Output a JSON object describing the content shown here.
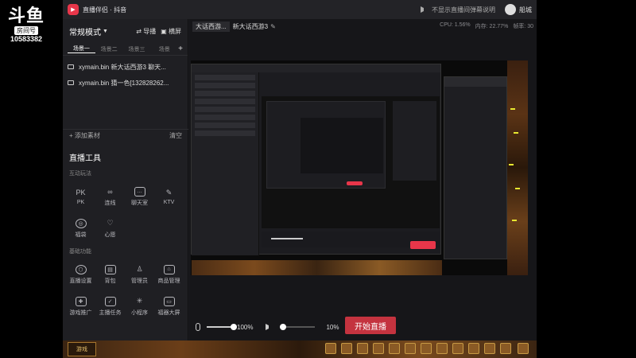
{
  "watermark": {
    "logo": "斗鱼",
    "room_label": "房间号",
    "room_number": "10583382"
  },
  "titlebar": {
    "app_name": "直播伴侣 · 抖音",
    "notice": "不显示直播间弹幕说明",
    "username": "船城"
  },
  "left_panel": {
    "mode": "常规模式",
    "import_label": "导播",
    "landscape_label": "横屏",
    "scene_tabs": [
      "场景一",
      "场景二",
      "场景三",
      "场景"
    ],
    "sources": [
      "xymain.bin 新大话西游3 聊天...",
      "xymain.bin 猜一色[132828262..."
    ],
    "add_material": "添加素材",
    "clear": "清空",
    "tools_title": "直播工具",
    "interactive_title": "互动玩法",
    "interactive_tools": [
      {
        "icon": "pk-icon",
        "label": "PK"
      },
      {
        "icon": "link-icon",
        "label": "连线"
      },
      {
        "icon": "chatroom-icon",
        "label": "聊天室"
      },
      {
        "icon": "mic-icon",
        "label": "KTV"
      },
      {
        "icon": "lock-icon",
        "label": "福袋"
      },
      {
        "icon": "heart-icon",
        "label": "心愿"
      }
    ],
    "basic_title": "基础功能",
    "basic_tools": [
      {
        "icon": "settings-hex-icon",
        "label": "直播设置"
      },
      {
        "icon": "bag-icon",
        "label": "背包"
      },
      {
        "icon": "admin-icon",
        "label": "管理员"
      },
      {
        "icon": "shop-icon",
        "label": "商品管理"
      },
      {
        "icon": "gamepad-icon",
        "label": "游戏推广"
      },
      {
        "icon": "task-icon",
        "label": "主播任务"
      },
      {
        "icon": "spark-icon",
        "label": "小程序"
      },
      {
        "icon": "cast-icon",
        "label": "福器大屏"
      }
    ]
  },
  "stage": {
    "scene_tab": "大话西游...",
    "scene_name": "新大话西游3",
    "cpu": "CPU: 1.56%",
    "memory": "内存: 22.77%",
    "fps": "帧率: 30",
    "mic_volume": "100%",
    "speaker_volume": "10%",
    "start_label": "开始直播"
  },
  "gamebar": {
    "left_label": "游戏"
  }
}
